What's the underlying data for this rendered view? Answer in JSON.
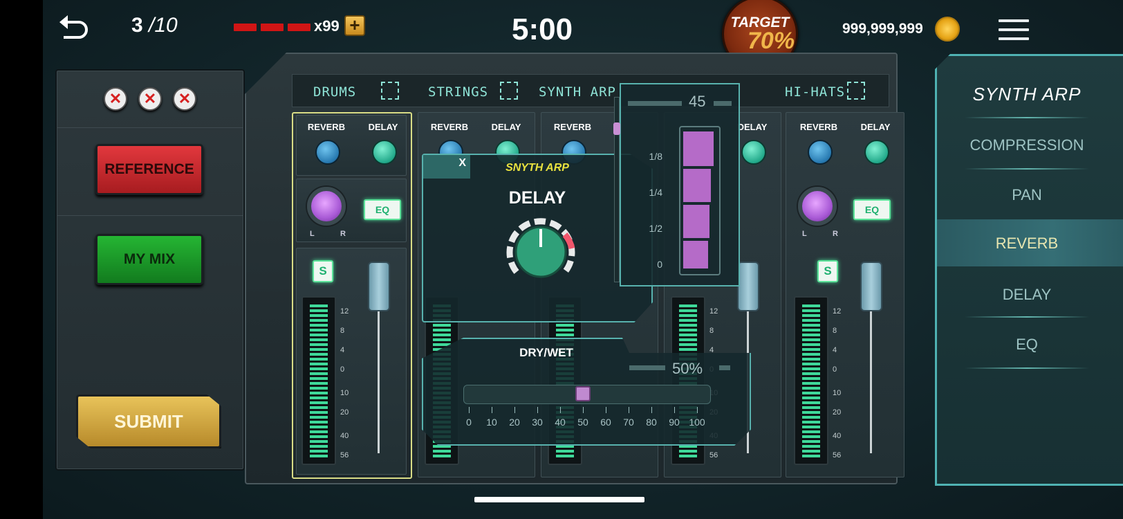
{
  "topbar": {
    "back_icon": "undo-arrow-icon",
    "progress_current": "3",
    "progress_total": "/10",
    "lives_count": "x99",
    "add_label": "+",
    "timer": "5:00",
    "target_label": "TARGET",
    "target_value": "70%",
    "coins": "999,999,999",
    "menu_icon": "hamburger-menu-icon"
  },
  "left_panel": {
    "strikes": [
      "✕",
      "✕",
      "✕"
    ],
    "reference_label": "REFERENCE",
    "mymix_label": "MY MIX",
    "submit_label": "SUBMIT"
  },
  "mixer": {
    "tabs": [
      "DRUMS",
      "STRINGS",
      "SYNTH ARP",
      "HI-HATS"
    ],
    "channel": {
      "reverb_label": "REVERB",
      "delay_label": "DELAY",
      "pan_l": "L",
      "pan_r": "R",
      "eq_label": "EQ",
      "solo_label": "S"
    },
    "scale": [
      "12",
      "8",
      "4",
      "0",
      "10",
      "20",
      "40",
      "56"
    ]
  },
  "delay_popup": {
    "close_label": "X",
    "subtitle": "SNYTH ARP",
    "title": "DELAY"
  },
  "time_popup": {
    "value": "45",
    "ticks": [
      "1/8",
      "1/4",
      "1/2",
      "0"
    ]
  },
  "drywet_popup": {
    "title": "DRY/WET",
    "value": "50%",
    "percent": 50,
    "ticks": [
      "0",
      "10",
      "20",
      "30",
      "40",
      "50",
      "60",
      "70",
      "80",
      "90",
      "100"
    ]
  },
  "right_panel": {
    "title": "SYNTH ARP",
    "items": [
      "COMPRESSION",
      "PAN",
      "REVERB",
      "DELAY",
      "EQ"
    ],
    "selected": "REVERB"
  },
  "colors": {
    "accent_teal": "#58b2ae",
    "reference_red": "#c8262a",
    "mymix_green": "#1a9a2b",
    "submit_gold": "#d9ad45"
  }
}
